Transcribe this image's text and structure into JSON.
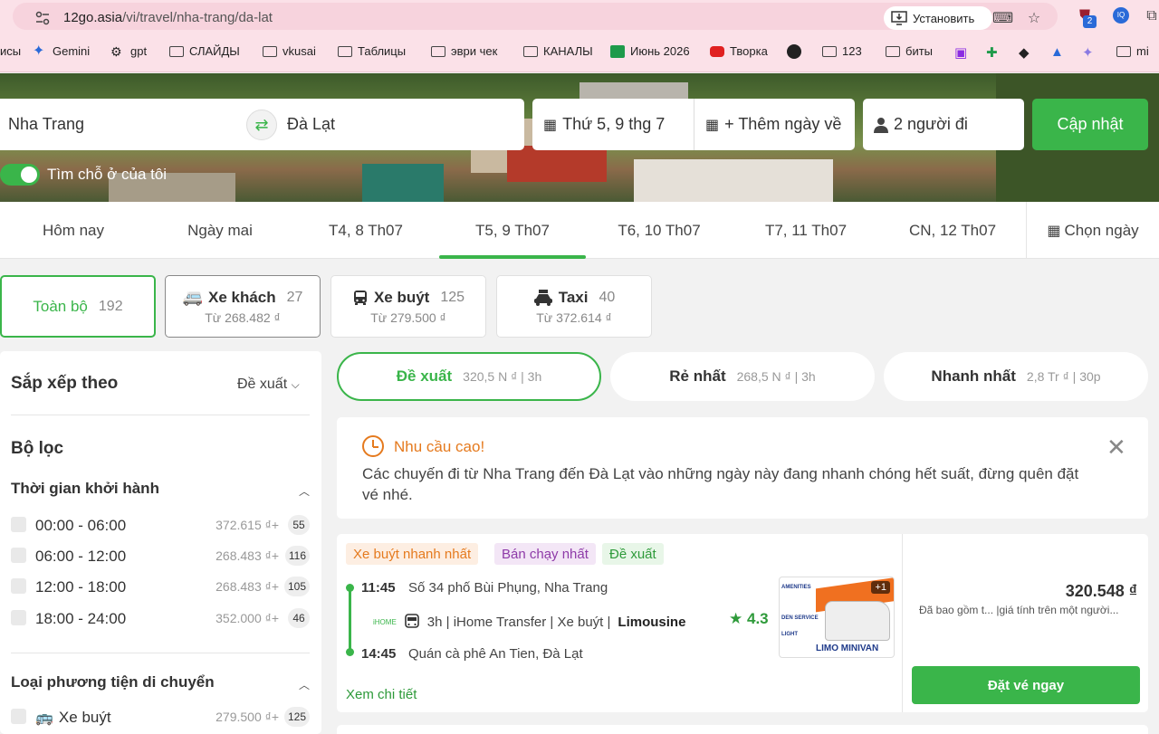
{
  "browser": {
    "url_host": "12go.asia",
    "url_path": "/vi/travel/nha-trang/da-lat",
    "install_label": "Установить",
    "ext_badge": "2",
    "ext2_label": "IQ"
  },
  "bookmarks": [
    {
      "label": "исы",
      "icon": "none"
    },
    {
      "label": "Gemini",
      "icon": "gemini-icon"
    },
    {
      "label": "gpt",
      "icon": "openai-icon"
    },
    {
      "label": "СЛАЙДЫ",
      "icon": "folder-icon"
    },
    {
      "label": "vkusai",
      "icon": "folder-icon"
    },
    {
      "label": "Таблицы",
      "icon": "folder-icon"
    },
    {
      "label": "эври чек",
      "icon": "folder-icon"
    },
    {
      "label": "КАНАЛЫ",
      "icon": "folder-icon"
    },
    {
      "label": "Июнь 2026",
      "icon": "sheet-icon"
    },
    {
      "label": "Творка",
      "icon": "youtube-icon"
    },
    {
      "label": "",
      "icon": "circle-icon"
    },
    {
      "label": "123",
      "icon": "folder-icon"
    },
    {
      "label": "биты",
      "icon": "folder-icon"
    },
    {
      "label": "mi",
      "icon": "folder-icon"
    }
  ],
  "search": {
    "from": "Nha Trang",
    "to": "Đà Lạt",
    "date": "Thứ 5, 9 thg 7",
    "return": "+ Thêm ngày về",
    "passengers": "2 người đi",
    "update_label": "Cập nhật",
    "toggle_label": "Tìm chỗ ở của tôi"
  },
  "date_tabs": [
    "Hôm nay",
    "Ngày mai",
    "T4, 8 Th07",
    "T5, 9 Th07",
    "T6, 10 Th07",
    "T7, 11 Th07",
    "CN, 12 Th07"
  ],
  "date_tab_active": 3,
  "pick_day": "Chọn ngày",
  "modes": [
    {
      "title": "Toàn bộ",
      "count": "192",
      "sub": ""
    },
    {
      "title": "Xe khách",
      "count": "27",
      "sub": "Từ 268.482 ₫"
    },
    {
      "title": "Xe buýt",
      "count": "125",
      "sub": "Từ 279.500 ₫"
    },
    {
      "title": "Taxi",
      "count": "40",
      "sub": "Từ 372.614 ₫"
    }
  ],
  "sidebar": {
    "sort_title": "Sắp xếp theo",
    "sort_value": "Đề xuất",
    "filter_title": "Bộ lọc",
    "departure_title": "Thời gian khởi hành",
    "departure_rows": [
      {
        "label": "00:00 - 06:00",
        "price": "372.615 ₫+",
        "count": "55"
      },
      {
        "label": "06:00 - 12:00",
        "price": "268.483 ₫+",
        "count": "116"
      },
      {
        "label": "12:00 - 18:00",
        "price": "268.483 ₫+",
        "count": "105"
      },
      {
        "label": "18:00 - 24:00",
        "price": "352.000 ₫+",
        "count": "46"
      }
    ],
    "vehicle_title": "Loại phương tiện di chuyển",
    "vehicle_rows": [
      {
        "label": "Xe buýt",
        "price": "279.500 ₫+",
        "count": "125"
      }
    ]
  },
  "sort_pills": [
    {
      "title": "Đề xuất",
      "sub": "320,5 N ₫ | 3h"
    },
    {
      "title": "Rẻ nhất",
      "sub": "268,5 N ₫ | 3h"
    },
    {
      "title": "Nhanh nhất",
      "sub": "2,8 Tr ₫ | 30p"
    }
  ],
  "alert": {
    "title": "Nhu cầu cao!",
    "text": "Các chuyến đi từ Nha Trang đến Đà Lạt vào những ngày này đang nhanh chóng hết suất, đừng quên đặt vé nhé."
  },
  "trip": {
    "tags": [
      "Xe buýt nhanh nhất",
      "Bán chạy nhất",
      "Đề xuất"
    ],
    "depart_time": "11:45",
    "depart_place": "Số 34 phố Bùi Phụng, Nha Trang",
    "brand": "iHOME",
    "info": "3h | iHome Transfer | Xe buýt |",
    "class": "Limousine",
    "arrive_time": "14:45",
    "arrive_place": "Quán cà phê An Tien, Đà Lạt",
    "rating": "4.3",
    "thumb_caption": "LIMO MINIVAN",
    "thumb_plus": "+1",
    "thumb_lines": [
      "AMENITIES",
      "DEN SERVICE",
      "LIGHT"
    ],
    "detail_label": "Xem chi tiết",
    "price": "320.548 ₫",
    "price_note": "Đã bao gồm t...  |giá tính trên một người...",
    "book_label": "Đặt vé ngay"
  },
  "colors": {
    "accent": "#3ab54a",
    "warning": "#e57a1e"
  }
}
